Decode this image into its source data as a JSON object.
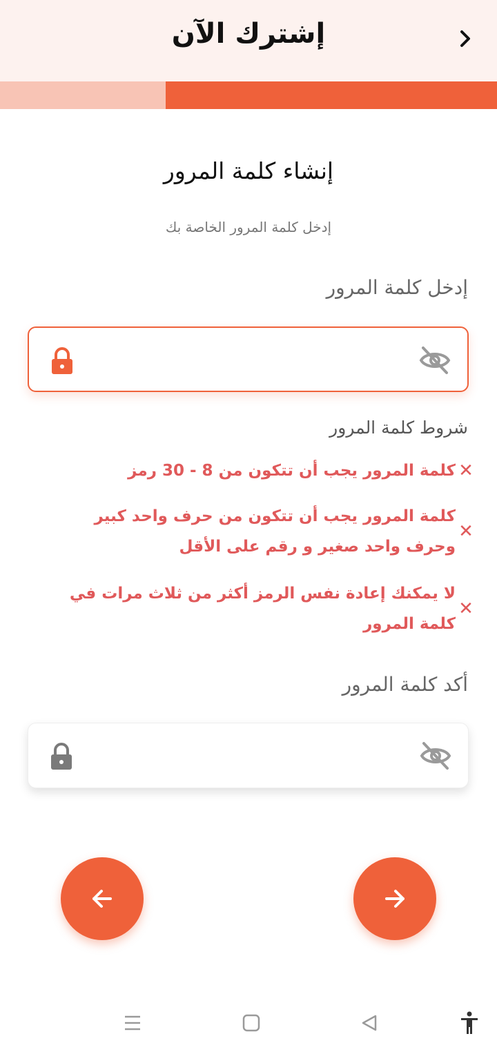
{
  "header": {
    "title": "إشترك الآن"
  },
  "progress": {
    "fraction": 0.667
  },
  "page": {
    "title": "إنشاء كلمة المرور",
    "subtitle": "إدخل كلمة المرور الخاصة بك"
  },
  "password": {
    "label": "إدخل كلمة المرور",
    "value": "",
    "placeholder": ""
  },
  "rules": {
    "title": "شروط كلمة المرور",
    "items": [
      {
        "text": "كلمة المرور يجب أن تتكون من 8 - 30 رمز"
      },
      {
        "text": "كلمة المرور يجب أن تتكون من حرف واحد كبير وحرف واحد صغير و رقم على الأقل"
      },
      {
        "text": "لا يمكنك إعادة نفس الرمز أكثر من ثلاث مرات في كلمة المرور"
      }
    ]
  },
  "confirm": {
    "label": "أكد كلمة المرور",
    "value": "",
    "placeholder": ""
  },
  "colors": {
    "accent": "#ef613a",
    "accent_light": "#f8c4b5",
    "error": "#e0595a",
    "header_bg": "#fdf2ef"
  },
  "icons": {
    "back": "chevron-right-icon",
    "lock": "lock-icon",
    "eye": "eye-off-icon",
    "rule_status": "close-icon",
    "prev": "arrow-left-icon",
    "next": "arrow-right-icon",
    "nav": [
      "menu-icon",
      "home-square-icon",
      "back-triangle-icon",
      "accessibility-icon"
    ]
  }
}
